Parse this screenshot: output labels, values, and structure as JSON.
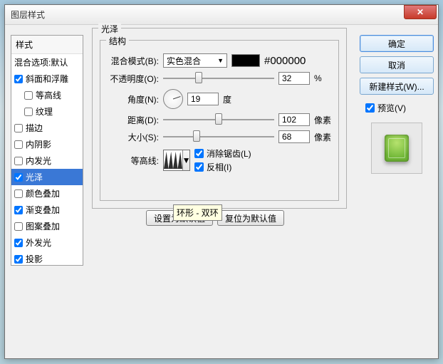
{
  "window": {
    "title": "图层样式"
  },
  "sidebar": {
    "header": "样式",
    "blend_opts": "混合选项:默认",
    "items": [
      {
        "label": "斜面和浮雕",
        "checked": true,
        "indent": false
      },
      {
        "label": "等高线",
        "checked": false,
        "indent": true
      },
      {
        "label": "纹理",
        "checked": false,
        "indent": true
      },
      {
        "label": "描边",
        "checked": false,
        "indent": false
      },
      {
        "label": "内阴影",
        "checked": false,
        "indent": false
      },
      {
        "label": "内发光",
        "checked": false,
        "indent": false
      },
      {
        "label": "光泽",
        "checked": true,
        "indent": false,
        "selected": true
      },
      {
        "label": "颜色叠加",
        "checked": false,
        "indent": false
      },
      {
        "label": "渐变叠加",
        "checked": true,
        "indent": false
      },
      {
        "label": "图案叠加",
        "checked": false,
        "indent": false
      },
      {
        "label": "外发光",
        "checked": true,
        "indent": false
      },
      {
        "label": "投影",
        "checked": true,
        "indent": false
      }
    ]
  },
  "panel": {
    "title": "光泽",
    "group": "结构",
    "blend_mode_label": "混合模式(B):",
    "blend_mode_value": "实色混合",
    "color_hex": "#000000",
    "opacity_label": "不透明度(O):",
    "opacity_value": "32",
    "opacity_unit": "%",
    "angle_label": "角度(N):",
    "angle_value": "19",
    "angle_unit": "度",
    "distance_label": "距离(D):",
    "distance_value": "102",
    "distance_unit": "像素",
    "size_label": "大小(S):",
    "size_value": "68",
    "size_unit": "像素",
    "contour_label": "等高线:",
    "anti_alias_label": "消除锯齿(L)",
    "anti_alias_checked": true,
    "invert_label": "反相(I)",
    "invert_checked": true
  },
  "tooltip": {
    "text": "环形 - 双环"
  },
  "buttons": {
    "set_default": "设置为默认值",
    "reset_default": "复位为默认值"
  },
  "right": {
    "ok": "确定",
    "cancel": "取消",
    "new_style": "新建样式(W)...",
    "preview_label": "预览(V)",
    "preview_checked": true
  }
}
